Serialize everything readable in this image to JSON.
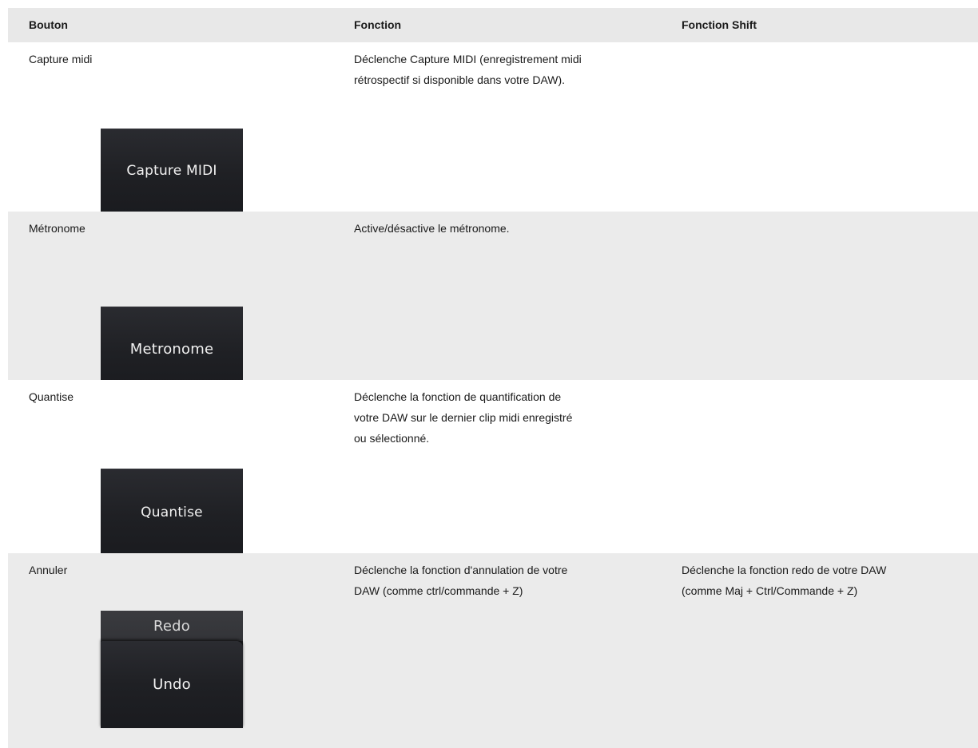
{
  "headers": {
    "col1": "Bouton",
    "col2": "Fonction",
    "col3": "Fonction Shift"
  },
  "rows": [
    {
      "button": "Capture midi",
      "function_lines": [
        "Déclenche Capture MIDI (enregistrement midi",
        "rétrospectif si disponible dans votre DAW)."
      ],
      "shift_lines": [],
      "image_label": "Capture MIDI"
    },
    {
      "button": "Métronome",
      "function_lines": [
        "Active/désactive le métronome."
      ],
      "shift_lines": [],
      "image_label": "Metronome"
    },
    {
      "button": "Quantise",
      "function_lines": [
        "Déclenche la fonction de quantification de",
        "votre DAW sur le dernier clip midi enregistré",
        "ou sélectionné."
      ],
      "shift_lines": [],
      "image_label": "Quantise"
    },
    {
      "button": "Annuler",
      "function_lines": [
        "Déclenche la fonction d'annulation de votre",
        "DAW (comme ctrl/commande + Z)"
      ],
      "shift_lines": [
        "Déclenche la fonction redo de votre DAW",
        "(comme Maj + Ctrl/Commande + Z)"
      ],
      "image_label": "Undo",
      "image_shift_label": "Redo"
    }
  ]
}
